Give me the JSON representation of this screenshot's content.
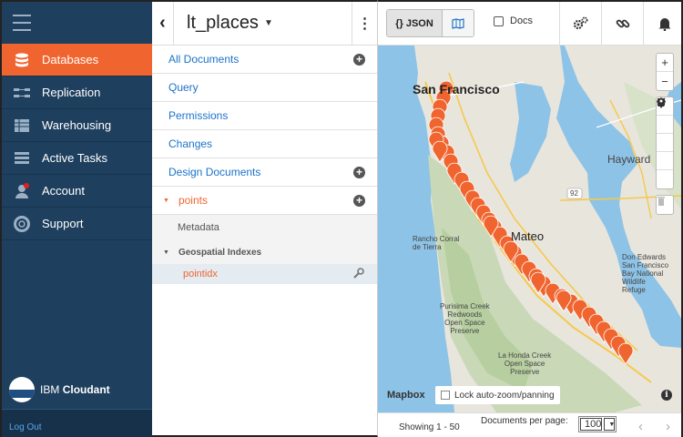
{
  "nav": {
    "items": [
      {
        "label": "Databases",
        "icon": "databases-icon",
        "active": true
      },
      {
        "label": "Replication",
        "icon": "replication-icon"
      },
      {
        "label": "Warehousing",
        "icon": "warehousing-icon"
      },
      {
        "label": "Active Tasks",
        "icon": "active-tasks-icon"
      },
      {
        "label": "Account",
        "icon": "account-icon"
      },
      {
        "label": "Support",
        "icon": "support-icon"
      }
    ],
    "brand_prefix": "IBM",
    "brand_name": "Cloudant",
    "logout": "Log Out"
  },
  "db": {
    "title": "lt_places"
  },
  "sidebar": {
    "all_documents": "All Documents",
    "query": "Query",
    "permissions": "Permissions",
    "changes": "Changes",
    "design_documents": "Design Documents",
    "points": "points",
    "metadata": "Metadata",
    "geospatial_indexes": "Geospatial Indexes",
    "pointidx": "pointidx"
  },
  "header": {
    "json_label": "{} JSON",
    "docs_label": "Docs"
  },
  "map": {
    "labels": {
      "san_francisco": "San Francisco",
      "hayward": "Hayward",
      "san_mateo": "Mateo",
      "rancho": "Rancho Corral\nde Tierra",
      "don_edwards": "Don Edwards\nSan Francisco\nBay National\nWildlife\nRefuge",
      "purisima": "Purisima Creek\nRedwoods\nOpen Space\nPreserve",
      "la_honda": "La Honda Creek\nOpen Space\nPreserve",
      "route_92": "92"
    },
    "mapbox": "Mapbox",
    "lock_zoom": "Lock auto-zoom/panning",
    "marker_color": "#f0652f"
  },
  "footer": {
    "showing": "Showing 1 - 50",
    "per_page_label": "Documents per page:",
    "per_page_value": "100"
  }
}
